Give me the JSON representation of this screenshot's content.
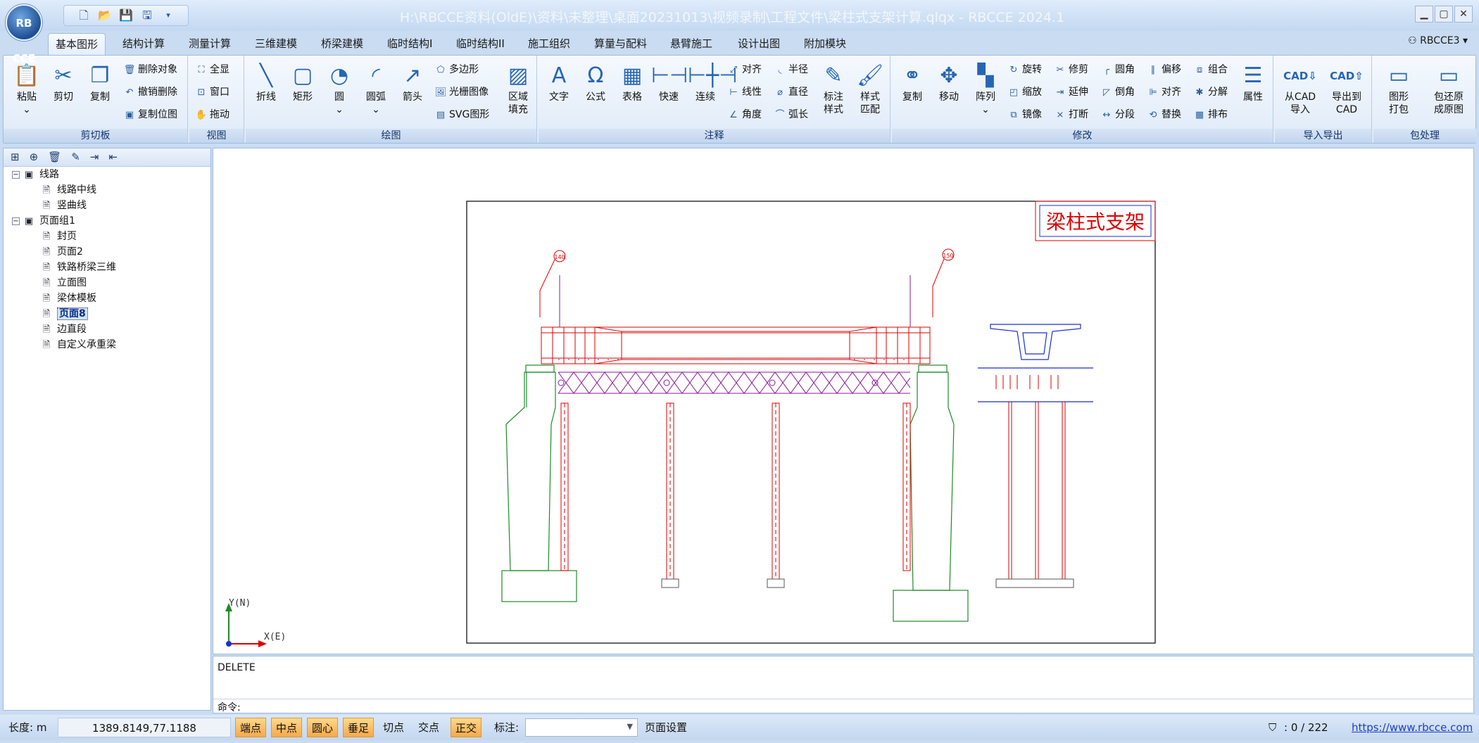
{
  "window": {
    "title": "H:\\RBCCE资料(OldE)\\资料\\未整理\\桌面20231013\\视频录制\\工程文件\\梁柱式支架计算.qlqx - RBCCE 2024.1",
    "logo": "RB CCE",
    "controls": [
      "minimize-icon",
      "maximize-icon",
      "close-icon"
    ]
  },
  "quick_access": [
    "new-file-icon",
    "open-folder-icon",
    "save-icon",
    "save-as-icon",
    "dropdown-arrow-icon"
  ],
  "tabs": [
    "基本图形",
    "结构计算",
    "测量计算",
    "三维建模",
    "桥梁建模",
    "临时结构I",
    "临时结构II",
    "施工组织",
    "算量与配料",
    "悬臂施工",
    "设计出图",
    "附加模块"
  ],
  "user": "RBCCE3",
  "ribbon": {
    "clipboard": {
      "label": "剪切板",
      "big": [
        "粘贴",
        "剪切",
        "复制"
      ],
      "small": [
        "删除对象",
        "撤销删除",
        "复制位图"
      ]
    },
    "view": {
      "label": "视图",
      "small": [
        "全显",
        "窗口",
        "拖动"
      ]
    },
    "draw": {
      "label": "绘图",
      "big": [
        "折线",
        "矩形",
        "圆",
        "圆弧",
        "箭头"
      ],
      "small": [
        "多边形",
        "光栅图像",
        "SVG图形"
      ],
      "fill": [
        "区域",
        "填充"
      ]
    },
    "annot": {
      "label": "注释",
      "big": [
        "文字",
        "公式",
        "表格",
        "快速",
        "连续"
      ],
      "small": [
        "对齐",
        "线性",
        "角度",
        "半径",
        "直径",
        "弧长"
      ],
      "style": [
        "标注",
        "样式"
      ],
      "match": [
        "样式",
        "匹配"
      ]
    },
    "modify": {
      "label": "修改",
      "big": [
        "复制",
        "移动",
        "阵列"
      ],
      "small": [
        "旋转",
        "缩放",
        "镜像",
        "修剪",
        "延伸",
        "打断",
        "圆角",
        "倒角",
        "分段",
        "偏移",
        "对齐",
        "替换",
        "组合",
        "分解",
        "排布"
      ],
      "prop": "属性"
    },
    "io": {
      "label": "导入导出",
      "from": [
        "从CAD",
        "导入"
      ],
      "to": [
        "导出到",
        "CAD"
      ]
    },
    "pack": {
      "label": "包处理",
      "pack": [
        "图形",
        "打包"
      ],
      "restore": [
        "包还原",
        "成原图"
      ]
    }
  },
  "tree": [
    {
      "label": "线路",
      "level": 0
    },
    {
      "label": "线路中线",
      "level": 1
    },
    {
      "label": "竖曲线",
      "level": 1
    },
    {
      "label": "页面组1",
      "level": 0
    },
    {
      "label": "封页",
      "level": 1
    },
    {
      "label": "页面2",
      "level": 1
    },
    {
      "label": "铁路桥梁三维",
      "level": 1
    },
    {
      "label": "立面图",
      "level": 1
    },
    {
      "label": "梁体模板",
      "level": 1
    },
    {
      "label": "页面8",
      "level": 1,
      "selected": true
    },
    {
      "label": "边直段",
      "level": 1
    },
    {
      "label": "自定义承重梁",
      "level": 1
    }
  ],
  "drawing": {
    "title": "梁柱式支架",
    "axis_y": "Y(N)",
    "axis_x": "X(E)",
    "left_marker": "140",
    "right_marker": "150"
  },
  "command": {
    "history": "DELETE",
    "prompt": "命令:"
  },
  "status": {
    "length_label": "长度: m",
    "coords": "1389.8149,77.1188",
    "snaps": [
      {
        "label": "端点",
        "on": true
      },
      {
        "label": "中点",
        "on": true
      },
      {
        "label": "圆心",
        "on": true
      },
      {
        "label": "垂足",
        "on": true
      },
      {
        "label": "切点",
        "on": false
      },
      {
        "label": "交点",
        "on": false
      },
      {
        "label": "正交",
        "on": true
      }
    ],
    "annot_label": "标注:",
    "page_setup": "页面设置",
    "count": ": 0 / 222",
    "url": "https://www.rbcce.com"
  },
  "colors": {
    "accent": "#2566b4",
    "red": "#e00000",
    "green": "#1f8a2a",
    "purple": "#8a1a9a",
    "blue": "#1a2fd0"
  }
}
